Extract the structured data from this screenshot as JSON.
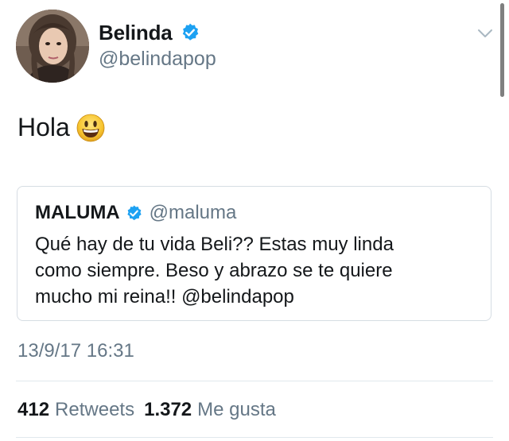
{
  "author": {
    "display_name": "Belinda",
    "handle": "@belindapop",
    "verified": true,
    "avatar_icon": "profile-photo"
  },
  "tweet": {
    "text": "Hola",
    "emoji": "smiling-face-emoji"
  },
  "quoted_tweet": {
    "display_name": "MALUMA",
    "handle": "@maluma",
    "verified": true,
    "text": "Qué hay de tu vida Beli?? Estas muy linda\ncomo siempre. Beso y abrazo se te quiere\nmucho mi reina!! @belindapop"
  },
  "timestamp": "13/9/17 16:31",
  "stats": {
    "retweets_count": "412",
    "retweets_label": "Retweets",
    "likes_count": "1.372",
    "likes_label": "Me gusta"
  },
  "colors": {
    "verified_blue": "#1da1f2",
    "secondary_text": "#657786",
    "border": "#d6dde3",
    "divider": "#e1e8ed"
  },
  "icons": {
    "caret": "chevron-down-icon",
    "verified": "verified-badge-icon"
  }
}
